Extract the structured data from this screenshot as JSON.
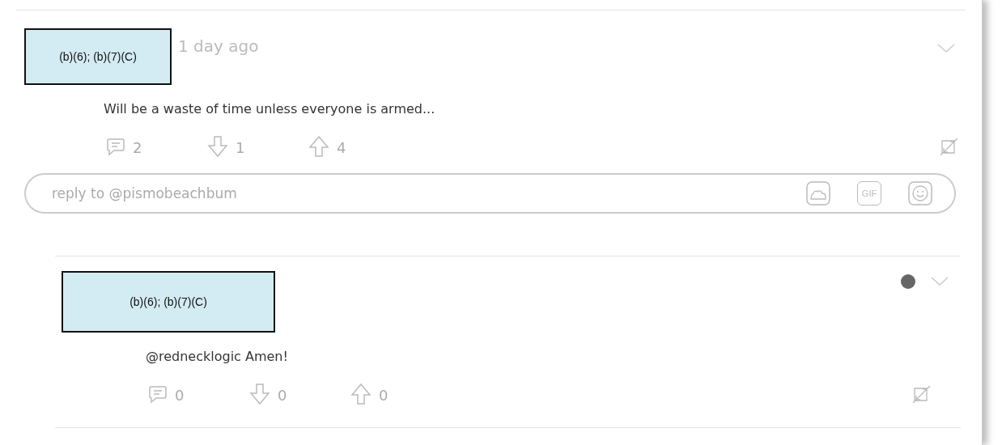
{
  "comments": [
    {
      "author": "(b)(6); (b)(7)(C)",
      "timestamp": "1 day ago",
      "text": "Will be a waste of time unless everyone is armed...",
      "replies": "2",
      "downvotes": "1",
      "upvotes": "4",
      "unread": false,
      "reply_field": {
        "placeholder": "reply to @pismobeachbum",
        "gif_label": "GIF"
      }
    },
    {
      "author": "(b)(6); (b)(7)(C)",
      "text": "@rednecklogic Amen!",
      "replies": "0",
      "downvotes": "0",
      "upvotes": "0",
      "unread": true
    }
  ]
}
